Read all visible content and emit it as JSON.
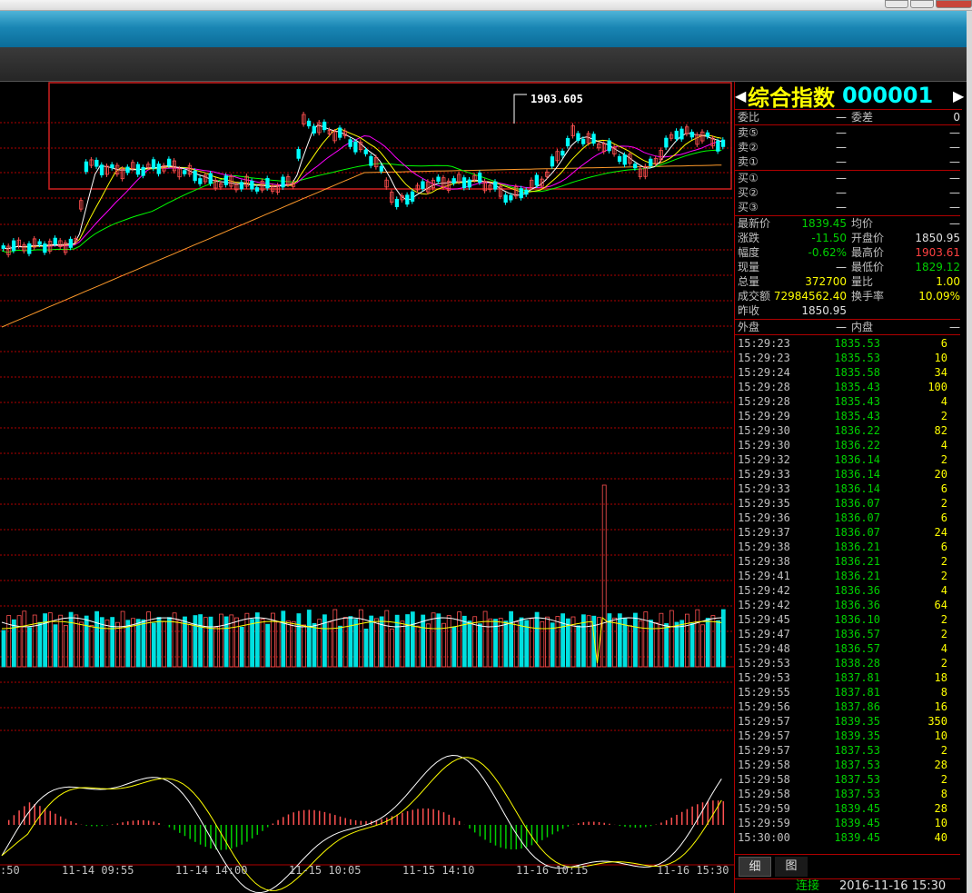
{
  "colors": {
    "background": "#000000",
    "grid": "#b00000",
    "up_candle": "#ff5050",
    "down_candle": "#00ffff",
    "ma5": "#ffffff",
    "ma10": "#ffff00",
    "ma20": "#ff00ff",
    "ma60": "#00ff00",
    "ma120": "#ff9a2a",
    "volume_up": "#ff5050",
    "volume_down": "#00e0e0",
    "macd_pos": "#ff5050",
    "macd_neg": "#00d000"
  },
  "stock": {
    "name": "综合指数",
    "code": "000001",
    "prev_arrow": "◀",
    "next_arrow": "▶"
  },
  "quote": {
    "wei_bi_label": "委比",
    "wei_bi": "—",
    "wei_cha_label": "委差",
    "wei_cha": "0",
    "asks": [
      {
        "label": "卖⑤",
        "price": "—",
        "vol": "—"
      },
      {
        "label": "卖②",
        "price": "—",
        "vol": "—"
      },
      {
        "label": "卖①",
        "price": "—",
        "vol": "—"
      }
    ],
    "bids": [
      {
        "label": "买①",
        "price": "—",
        "vol": "—"
      },
      {
        "label": "买②",
        "price": "—",
        "vol": "—"
      },
      {
        "label": "买③",
        "price": "—",
        "vol": "—"
      }
    ],
    "stats": [
      {
        "l1": "最新价",
        "v1": "1839.45",
        "c1": "c-green",
        "l2": "均价",
        "v2": "—",
        "c2": "c-white"
      },
      {
        "l1": "涨跌",
        "v1": "-11.50",
        "c1": "c-green",
        "l2": "开盘价",
        "v2": "1850.95",
        "c2": "c-white"
      },
      {
        "l1": "幅度",
        "v1": "-0.62%",
        "c1": "c-green",
        "l2": "最高价",
        "v2": "1903.61",
        "c2": "c-red"
      },
      {
        "l1": "现量",
        "v1": "—",
        "c1": "c-white",
        "l2": "最低价",
        "v2": "1829.12",
        "c2": "c-green"
      },
      {
        "l1": "总量",
        "v1": "372700",
        "c1": "c-yellow",
        "l2": "量比",
        "v2": "1.00",
        "c2": "c-yellow"
      },
      {
        "l1": "成交额",
        "v1": "72984562.40",
        "c1": "c-yellow",
        "l2": "换手率",
        "v2": "10.09%",
        "c2": "c-yellow"
      },
      {
        "l1": "昨收",
        "v1": "1850.95",
        "c1": "c-white",
        "l2": "",
        "v2": "",
        "c2": "c-white"
      }
    ],
    "outer_label": "外盘",
    "outer": "—",
    "inner_label": "内盘",
    "inner": "—"
  },
  "ticks": [
    {
      "time": "15:29:23",
      "price": "1835.53",
      "vol": "6"
    },
    {
      "time": "15:29:23",
      "price": "1835.53",
      "vol": "10"
    },
    {
      "time": "15:29:24",
      "price": "1835.58",
      "vol": "34"
    },
    {
      "time": "15:29:28",
      "price": "1835.43",
      "vol": "100"
    },
    {
      "time": "15:29:28",
      "price": "1835.43",
      "vol": "4"
    },
    {
      "time": "15:29:29",
      "price": "1835.43",
      "vol": "2"
    },
    {
      "time": "15:29:30",
      "price": "1836.22",
      "vol": "82"
    },
    {
      "time": "15:29:30",
      "price": "1836.22",
      "vol": "4"
    },
    {
      "time": "15:29:32",
      "price": "1836.14",
      "vol": "2"
    },
    {
      "time": "15:29:33",
      "price": "1836.14",
      "vol": "20"
    },
    {
      "time": "15:29:33",
      "price": "1836.14",
      "vol": "6"
    },
    {
      "time": "15:29:35",
      "price": "1836.07",
      "vol": "2"
    },
    {
      "time": "15:29:36",
      "price": "1836.07",
      "vol": "6"
    },
    {
      "time": "15:29:37",
      "price": "1836.07",
      "vol": "24"
    },
    {
      "time": "15:29:38",
      "price": "1836.21",
      "vol": "6"
    },
    {
      "time": "15:29:38",
      "price": "1836.21",
      "vol": "2"
    },
    {
      "time": "15:29:41",
      "price": "1836.21",
      "vol": "2"
    },
    {
      "time": "15:29:42",
      "price": "1836.36",
      "vol": "4"
    },
    {
      "time": "15:29:42",
      "price": "1836.36",
      "vol": "64"
    },
    {
      "time": "15:29:45",
      "price": "1836.10",
      "vol": "2"
    },
    {
      "time": "15:29:47",
      "price": "1836.57",
      "vol": "2"
    },
    {
      "time": "15:29:48",
      "price": "1836.57",
      "vol": "4"
    },
    {
      "time": "15:29:53",
      "price": "1838.28",
      "vol": "2"
    },
    {
      "time": "15:29:53",
      "price": "1837.81",
      "vol": "18"
    },
    {
      "time": "15:29:55",
      "price": "1837.81",
      "vol": "8"
    },
    {
      "time": "15:29:56",
      "price": "1837.86",
      "vol": "16"
    },
    {
      "time": "15:29:57",
      "price": "1839.35",
      "vol": "350"
    },
    {
      "time": "15:29:57",
      "price": "1839.35",
      "vol": "10"
    },
    {
      "time": "15:29:57",
      "price": "1837.53",
      "vol": "2"
    },
    {
      "time": "15:29:58",
      "price": "1837.53",
      "vol": "28"
    },
    {
      "time": "15:29:58",
      "price": "1837.53",
      "vol": "2"
    },
    {
      "time": "15:29:58",
      "price": "1837.53",
      "vol": "8"
    },
    {
      "time": "15:29:59",
      "price": "1839.45",
      "vol": "28"
    },
    {
      "time": "15:29:59",
      "price": "1839.45",
      "vol": "10"
    },
    {
      "time": "15:30:00",
      "price": "1839.45",
      "vol": "40"
    }
  ],
  "tabs": {
    "detail": "细",
    "chart": "图"
  },
  "status": {
    "connection": "连接",
    "datetime": "2016-11-16  15:30"
  },
  "chart_data": {
    "type": "candlestick",
    "high_label": "1903.605",
    "x_ticks": [
      ":50",
      "11-14  09:55",
      "11-14  14:00",
      "11-15  10:05",
      "11-15  14:10",
      "11-16  10:15",
      "11-16  15:30"
    ]
  }
}
